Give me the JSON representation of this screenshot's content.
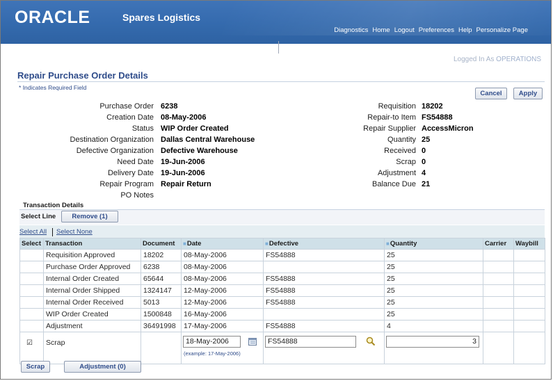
{
  "header": {
    "logo": "ORACLE",
    "app_title": "Spares Logistics",
    "links": [
      "Diagnostics",
      "Home",
      "Logout",
      "Preferences",
      "Help",
      "Personalize Page"
    ]
  },
  "user": {
    "prefix": "Logged In As",
    "name": "OPERATIONS"
  },
  "page": {
    "title": "Repair Purchase Order Details",
    "required_note": "Indicates Required Field",
    "cancel_label": "Cancel",
    "apply_label": "Apply"
  },
  "details_left": [
    {
      "label": "Purchase Order",
      "value": "6238"
    },
    {
      "label": "Creation Date",
      "value": "08-May-2006"
    },
    {
      "label": "Status",
      "value": "WIP Order Created"
    },
    {
      "label": "Destination Organization",
      "value": "Dallas Central Warehouse"
    },
    {
      "label": "Defective Organization",
      "value": "Defective Warehouse"
    },
    {
      "label": "Need Date",
      "value": "19-Jun-2006"
    },
    {
      "label": "Delivery Date",
      "value": "19-Jun-2006"
    },
    {
      "label": "Repair Program",
      "value": "Repair Return"
    },
    {
      "label": "PO Notes",
      "value": ""
    }
  ],
  "details_right": [
    {
      "label": "Requisition",
      "value": "18202"
    },
    {
      "label": "Repair-to Item",
      "value": "FS54888"
    },
    {
      "label": "Repair Supplier",
      "value": "AccessMicron"
    },
    {
      "label": "Quantity",
      "value": "25"
    },
    {
      "label": "Received",
      "value": "0"
    },
    {
      "label": "Scrap",
      "value": "0"
    },
    {
      "label": "Adjustment",
      "value": "4"
    },
    {
      "label": "Balance Due",
      "value": "21"
    }
  ],
  "transactions": {
    "title": "Transaction Details",
    "select_line_label": "Select Line",
    "remove_label": "Remove (1)",
    "select_all": "Select All",
    "select_none": "Select None",
    "columns": [
      "Select",
      "Transaction",
      "Document",
      "Date",
      "Defective",
      "Quantity",
      "Carrier",
      "Waybill"
    ],
    "rows": [
      {
        "transaction": "Requisition Approved",
        "document": "18202",
        "date": "08-May-2006",
        "defective": "FS54888",
        "quantity": "25"
      },
      {
        "transaction": "Purchase Order Approved",
        "document": "6238",
        "date": "08-May-2006",
        "defective": "",
        "quantity": "25"
      },
      {
        "transaction": "Internal Order Created",
        "document": "65644",
        "date": "08-May-2006",
        "defective": "FS54888",
        "quantity": "25"
      },
      {
        "transaction": "Internal Order Shipped",
        "document": "1324147",
        "date": "12-May-2006",
        "defective": "FS54888",
        "quantity": "25"
      },
      {
        "transaction": "Internal Order Received",
        "document": "5013",
        "date": "12-May-2006",
        "defective": "FS54888",
        "quantity": "25"
      },
      {
        "transaction": "WIP Order Created",
        "document": "1500848",
        "date": "16-May-2006",
        "defective": "",
        "quantity": "25"
      },
      {
        "transaction": "Adjustment",
        "document": "36491998",
        "date": "17-May-2006",
        "defective": "FS54888",
        "quantity": "4"
      }
    ],
    "entry": {
      "checked": true,
      "check_glyph": "☑",
      "transaction": "Scrap",
      "date_value": "18-May-2006",
      "date_hint": "(example: 17-May-2006)",
      "defective_value": "FS54888",
      "quantity_value": "3"
    },
    "scrap_label": "Scrap",
    "adjustment_label": "Adjustment (0)"
  }
}
